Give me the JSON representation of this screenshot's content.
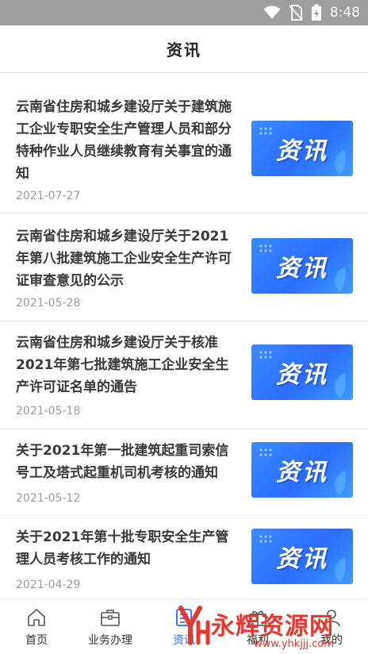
{
  "status_bar": {
    "time": "8:48",
    "icons": [
      "wifi-icon",
      "no-sim-icon",
      "battery-charging-icon"
    ]
  },
  "header": {
    "title": "资讯"
  },
  "news": [
    {
      "title": "云南省住房和城乡建设厅关于建筑施工企业专职安全生产管理人员和部分特种作业人员继续教育有关事宜的通知",
      "date": "2021-07-27",
      "thumb_label": "资讯"
    },
    {
      "title": "云南省住房和城乡建设厅关于2021年第八批建筑施工企业安全生产许可证审查意见的公示",
      "date": "2021-05-28",
      "thumb_label": "资讯"
    },
    {
      "title": "云南省住房和城乡建设厅关于核准2021年第七批建筑施工企业安全生产许可证名单的通告",
      "date": "2021-05-18",
      "thumb_label": "资讯"
    },
    {
      "title": "关于2021年第一批建筑起重司索信号工及塔式起重机司机考核的通知",
      "date": "2021-05-12",
      "thumb_label": "资讯"
    },
    {
      "title": "关于2021年第十批专职安全生产管理人员考核工作的通知",
      "date": "2021-04-29",
      "thumb_label": "资讯"
    }
  ],
  "tabs": [
    {
      "label": "首页",
      "icon": "home-icon"
    },
    {
      "label": "业务办理",
      "icon": "briefcase-icon"
    },
    {
      "label": "资讯",
      "icon": "news-icon",
      "active": true
    },
    {
      "label": "福利",
      "icon": "gift-icon"
    },
    {
      "label": "我的",
      "icon": "user-icon"
    }
  ],
  "watermark": {
    "text": "永辉资源网",
    "url": "www.yhkjjj.com"
  },
  "colors": {
    "accent": "#2f6ef5",
    "thumb_blue": "#2c6dfb",
    "watermark_red": "#e8372d"
  }
}
